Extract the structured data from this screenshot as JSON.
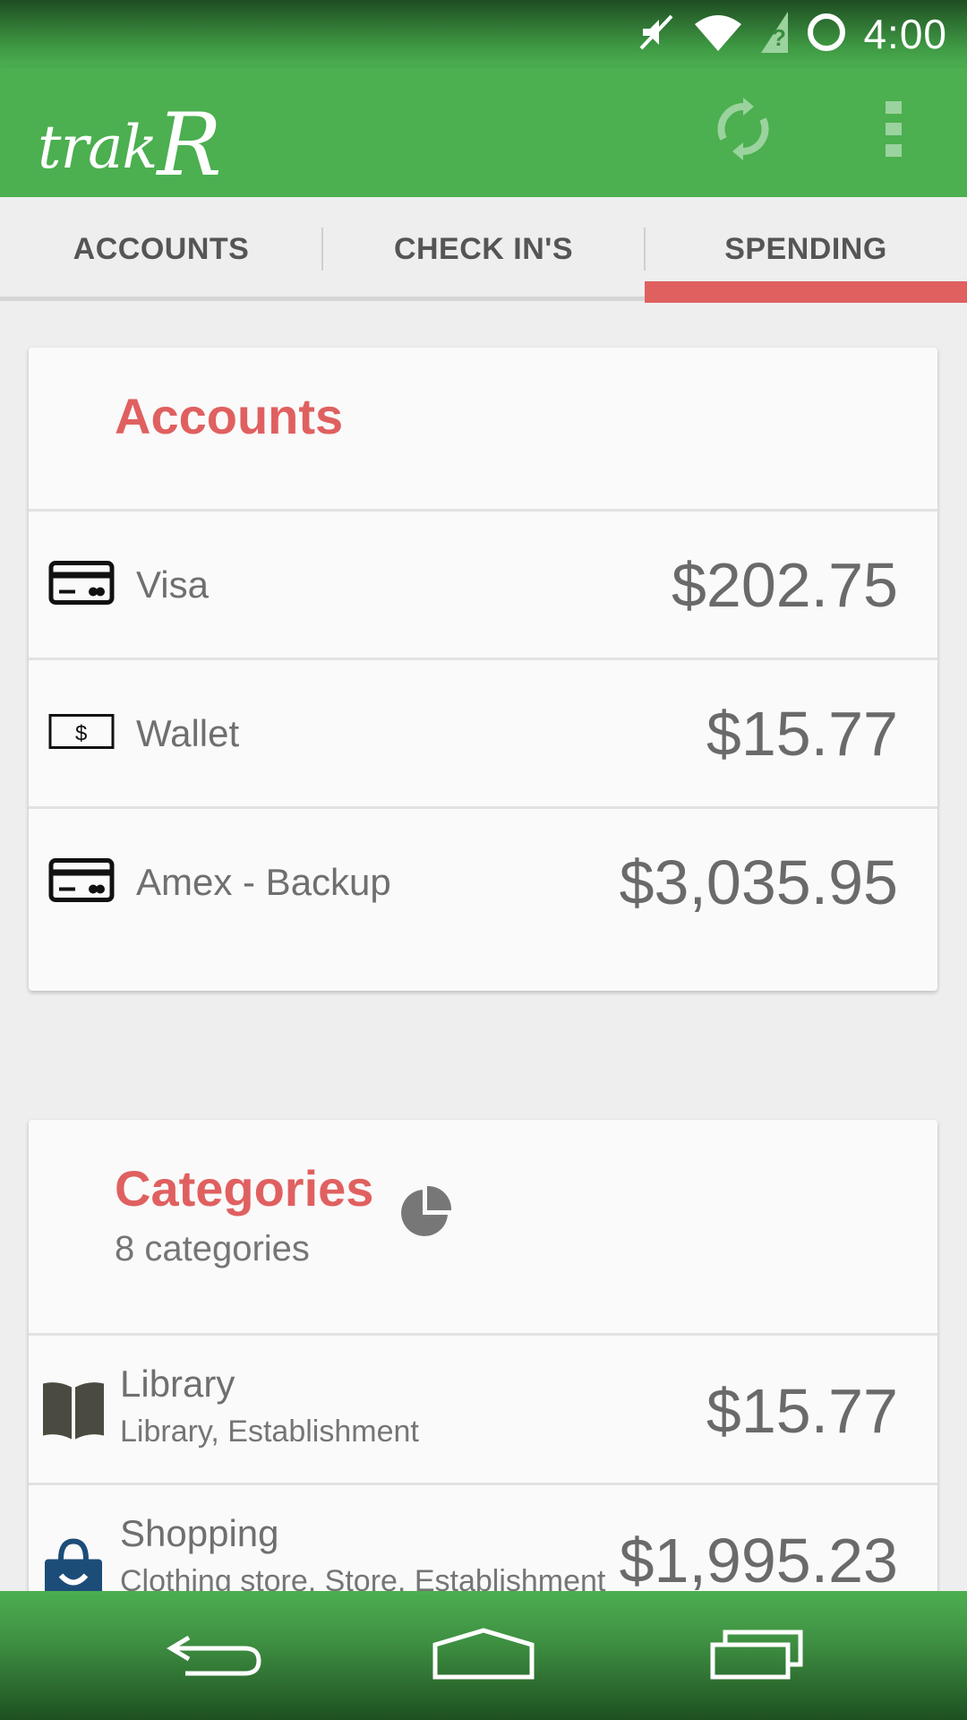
{
  "status_bar": {
    "time": "4:00",
    "icons": [
      "mute-icon",
      "wifi-icon",
      "no-sim-icon",
      "battery-icon"
    ]
  },
  "app_bar": {
    "logo_prefix": "trak",
    "logo_suffix": "R",
    "icons": [
      "sync-icon",
      "overflow-menu-icon"
    ]
  },
  "tabs": [
    {
      "label": "ACCOUNTS"
    },
    {
      "label": "CHECK IN'S"
    },
    {
      "label": "SPENDING",
      "selected": true
    }
  ],
  "accounts_card": {
    "title": "Accounts",
    "rows": [
      {
        "icon": "credit-card-icon",
        "name": "Visa",
        "amount": "$202.75"
      },
      {
        "icon": "cash-icon",
        "name": "Wallet",
        "amount": "$15.77"
      },
      {
        "icon": "credit-card-icon",
        "name": "Amex - Backup",
        "amount": "$3,035.95"
      }
    ]
  },
  "categories_card": {
    "title": "Categories",
    "subtitle": "8 categories",
    "rows": [
      {
        "icon": "book-icon",
        "name": "Library",
        "desc": "Library, Establishment",
        "amount": "$15.77"
      },
      {
        "icon": "shopping-bag-icon",
        "name": "Shopping",
        "desc": "Clothing store, Store, Establishment",
        "amount": "$1,995.23"
      }
    ]
  },
  "nav_bar": {
    "icons": [
      "back-icon",
      "home-icon",
      "recents-icon"
    ]
  },
  "colors": {
    "primary": "#4caf50",
    "accent": "#e06060",
    "background": "#eeeeee",
    "card": "#fafafa"
  }
}
